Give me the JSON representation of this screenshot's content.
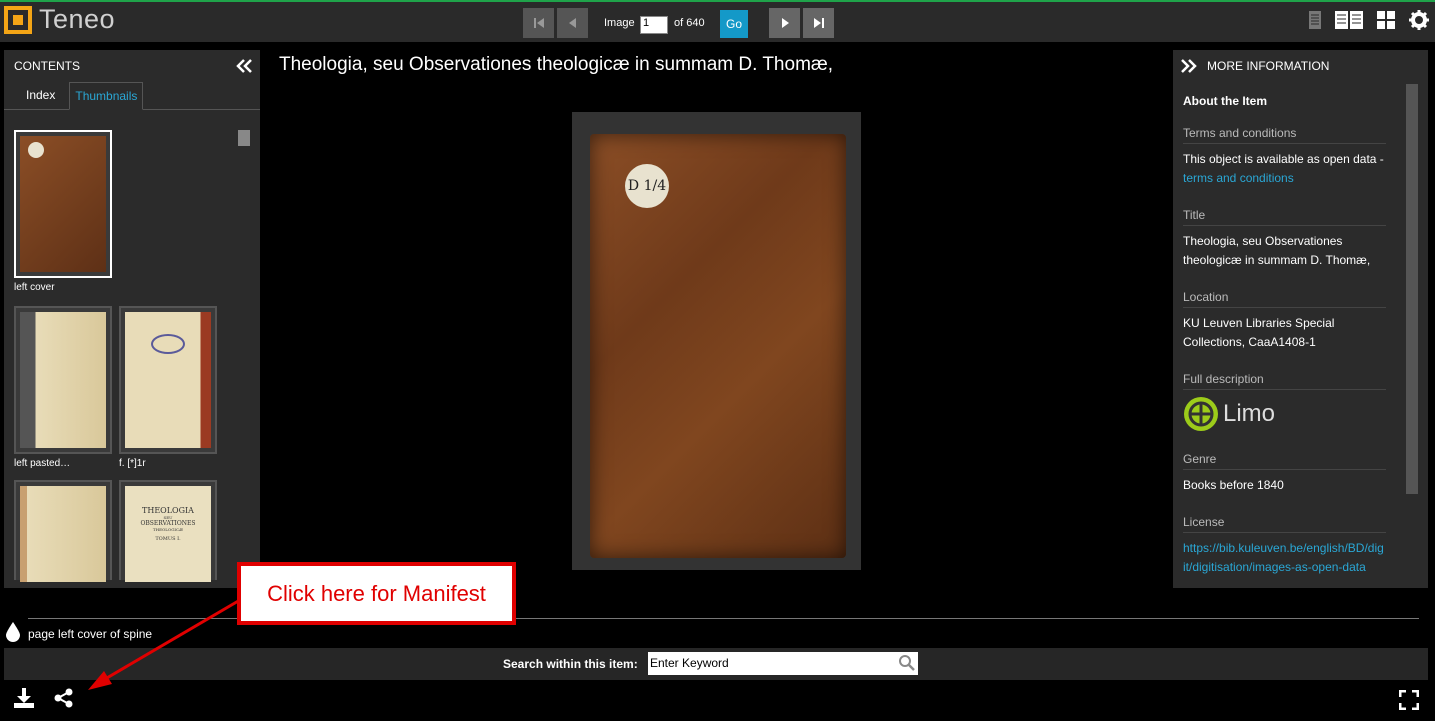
{
  "app": {
    "logo_text": "Teneo"
  },
  "nav": {
    "image_label": "Image",
    "image_value": "1",
    "of_label": "of 640",
    "go_label": "Go"
  },
  "contents": {
    "heading": "CONTENTS",
    "tabs": [
      {
        "label": "Index"
      },
      {
        "label": "Thumbnails"
      }
    ],
    "thumbnails": [
      {
        "caption": "left cover"
      },
      {
        "caption": "left pasted…"
      },
      {
        "caption": "f. [*]1r"
      },
      {
        "caption": ""
      },
      {
        "caption": ""
      }
    ],
    "thumb5_text": [
      "THEOLOGIA",
      "SEU",
      "OBSERVATIONES",
      "THEOLOGICÆ",
      "TOMUS I."
    ]
  },
  "viewer": {
    "title": "Theologia, seu Observationes theologicæ in summam D. Thomæ,",
    "book_label": "D 1/4"
  },
  "info": {
    "heading": "MORE INFORMATION",
    "about": "About the Item",
    "terms_label": "Terms and conditions",
    "terms_text": "This object is available as open data -",
    "terms_link": "terms and conditions",
    "title_label": "Title",
    "title_value": "Theologia, seu Observationes theologicæ in summam D. Thomæ,",
    "location_label": "Location",
    "location_value": "KU Leuven Libraries Special Collections, CaaA1408-1",
    "desc_label": "Full description",
    "limo_text": "Limo",
    "genre_label": "Genre",
    "genre_value": "Books before 1840",
    "license_label": "License",
    "license_link": "https://bib.kuleuven.be/english/BD/digit/digitisation/images-as-open-data"
  },
  "footer": {
    "page_label": "page left cover of spine",
    "search_label": "Search within this item:",
    "search_placeholder": "Enter Keyword"
  },
  "callout": {
    "text": "Click here for Manifest"
  },
  "colors": {
    "accent": "#1499c8",
    "link": "#2aa7d5",
    "logo": "#f4a516",
    "callout": "#e00000"
  }
}
